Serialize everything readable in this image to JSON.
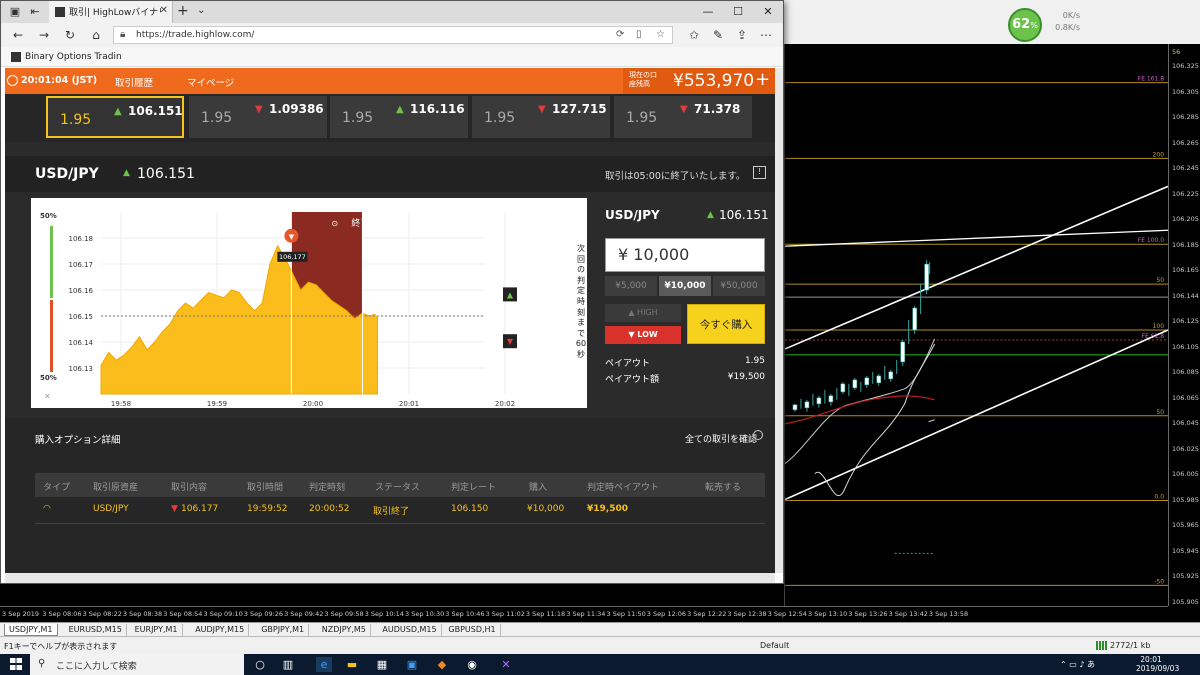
{
  "mt4": {
    "cpu_pct": "62",
    "cpu_unit": "%",
    "net_up": "0K/s",
    "net_down": "0.8K/s",
    "period_label": "56",
    "price_labels": [
      "106.325",
      "106.305",
      "106.285",
      "106.265",
      "106.245",
      "106.225",
      "106.205",
      "106.185",
      "106.165",
      "106.144",
      "106.125",
      "106.105",
      "106.085",
      "106.065",
      "106.045",
      "106.025",
      "106.005",
      "105.985",
      "105.965",
      "105.945",
      "105.925",
      "105.905"
    ],
    "fib_labels": [
      "FE 161.8",
      "200",
      "FE 100.0",
      "50",
      "100",
      "FE 61.8",
      "50",
      "0.0",
      "-50"
    ],
    "time_labels": [
      "3 Sep 2019",
      "3 Sep 08:06",
      "3 Sep 08:22",
      "3 Sep 08:38",
      "3 Sep 08:54",
      "3 Sep 09:10",
      "3 Sep 09:26",
      "3 Sep 09:42",
      "3 Sep 09:58",
      "3 Sep 10:14",
      "3 Sep 10:30",
      "3 Sep 10:46",
      "3 Sep 11:02",
      "3 Sep 11:18",
      "3 Sep 11:34",
      "3 Sep 11:50",
      "3 Sep 12:06",
      "3 Sep 12:22",
      "3 Sep 12:38",
      "3 Sep 12:54",
      "3 Sep 13:10",
      "3 Sep 13:26",
      "3 Sep 13:42",
      "3 Sep 13:58"
    ],
    "symbol_tabs": [
      "USDJPY,M1",
      "EURUSD,M15",
      "EURJPY,M1",
      "AUDJPY,M15",
      "GBPJPY,M1",
      "NZDJPY,M5",
      "AUDUSD,M15",
      "GBPUSD,H1"
    ],
    "status_help": "F1キーでヘルプが表示されます",
    "status_profile": "Default",
    "status_traffic": "2772/1 kb"
  },
  "browser": {
    "tab_title": "取引| HighLowバイナリーオ",
    "url": "https://trade.highlow.com/",
    "favorite": "Binary Options Tradin"
  },
  "highlow": {
    "clock": "20:01:04 (JST)",
    "menu": [
      "取引履歴",
      "マイページ"
    ],
    "balance_label": "現在の口座残高",
    "balance": "¥553,970",
    "assets": [
      {
        "payout": "1.95",
        "dir": "up",
        "rate": "106.151"
      },
      {
        "payout": "1.95",
        "dir": "down",
        "rate": "1.09386"
      },
      {
        "payout": "1.95",
        "dir": "up",
        "rate": "116.116"
      },
      {
        "payout": "1.95",
        "dir": "down",
        "rate": "127.715"
      },
      {
        "payout": "1.95",
        "dir": "down",
        "rate": "71.378"
      }
    ],
    "pair": "USD/JPY",
    "pair_rate": "106.151",
    "pair_notice": "取引は05:00に終了いたします。",
    "chart_end_label": "終了",
    "chart_marker": "106.177",
    "chart_vertical_note": "次回の判定時刻まで60秒",
    "pct_top": "50%",
    "pct_bottom": "50%",
    "amount": "¥ 10,000",
    "presets": [
      "¥5,000",
      "¥10,000",
      "¥50,000"
    ],
    "high_label": "HIGH",
    "low_label": "LOW",
    "buy_label": "今すぐ購入",
    "payout_label": "ペイアウト",
    "payout_value": "1.95",
    "payout_amount_label": "ペイアウト額",
    "payout_amount_value": "¥19,500",
    "purchase_title": "購入オプション詳細",
    "purchase_all": "全ての取引を確認",
    "table_headers": [
      "タイプ",
      "取引原資産",
      "取引内容",
      "取引時間",
      "判定時刻",
      "ステータス",
      "判定レート",
      "購入",
      "判定時ペイアウト",
      "転売する"
    ],
    "table_row": {
      "asset": "USD/JPY",
      "direction": "106.177",
      "time": "19:59:52",
      "expiry": "20:00:52",
      "status": "取引終了",
      "close_rate": "106.150",
      "amount": "¥10,000",
      "payout": "¥19,500"
    }
  },
  "taskbar": {
    "search_placeholder": "ここに入力して検索",
    "time": "20:01",
    "date": "2019/09/03"
  },
  "chart_data": {
    "type": "area",
    "x_ticks": [
      "19:58",
      "19:59",
      "20:00",
      "20:01",
      "20:02"
    ],
    "y_ticks": [
      106.18,
      106.17,
      106.16,
      106.15,
      106.14,
      106.13
    ],
    "ylim": [
      106.12,
      106.19
    ],
    "strike": 106.15,
    "entry_marker": {
      "label": "106.177",
      "value": 106.177
    },
    "series": [
      {
        "values": [
          106.131,
          106.136,
          106.133,
          106.135,
          106.138,
          106.142,
          106.137,
          106.14,
          106.144,
          106.147,
          106.152,
          106.155,
          106.153,
          106.156,
          106.159,
          106.158,
          106.157,
          106.16,
          106.159,
          106.155,
          106.152,
          106.155,
          106.17,
          106.177,
          106.172,
          106.166,
          106.16,
          106.163,
          106.162,
          106.159,
          106.156,
          106.154,
          106.152,
          106.149,
          106.151,
          106.15,
          106.151
        ]
      }
    ]
  }
}
